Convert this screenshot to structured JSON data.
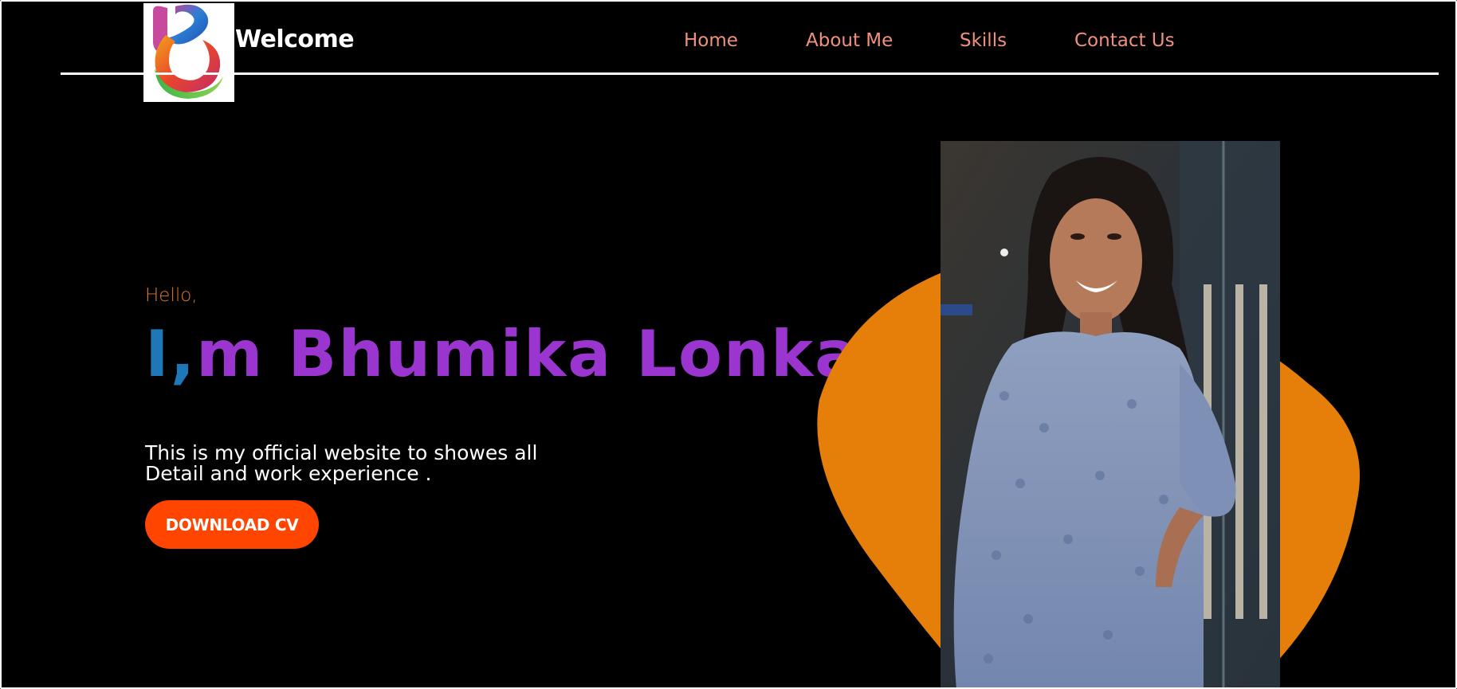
{
  "header": {
    "brand": "Welcome",
    "logo_icon": "stylized-b-logo-icon",
    "nav": [
      {
        "label": "Home"
      },
      {
        "label": "About Me"
      },
      {
        "label": "Skills"
      },
      {
        "label": "Contact Us"
      }
    ]
  },
  "hero": {
    "greeting": "Hello,",
    "name_lead": "I,",
    "name_rest": "m Bhumika Lonkar",
    "tagline_line1": "This is my official website to showes all",
    "tagline_line2": "Detail and work experience .",
    "cta_label": "DOWNLOAD CV"
  },
  "colors": {
    "background": "#000000",
    "nav_link": "#f0917e",
    "greeting": "#e07b2c",
    "name_lead": "#1e78b8",
    "name_rest": "#9a35d0",
    "cta": "#ff4500",
    "blob": "#e67e0a"
  }
}
